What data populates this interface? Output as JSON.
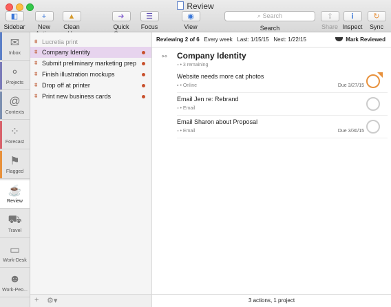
{
  "window": {
    "title": "Review"
  },
  "toolbar": {
    "sidebar": "Sidebar",
    "new_action": "New Action",
    "clean_up": "Clean Up",
    "quick_open": "Quick Open",
    "focus": "Focus",
    "view": "View",
    "search_placeholder": "Search",
    "search_label": "Search",
    "share": "Share",
    "inspect": "Inspect",
    "sync": "Sync"
  },
  "perspectives": [
    {
      "label": "Inbox",
      "icon": "inbox-icon",
      "stripe": "#5b7fc7"
    },
    {
      "label": "Projects",
      "icon": "projects-icon",
      "stripe": "#7a7ab8"
    },
    {
      "label": "Contexts",
      "icon": "contexts-icon",
      "stripe": "#7c8fb0"
    },
    {
      "label": "Forecast",
      "icon": "forecast-icon",
      "stripe": "#d8626b"
    },
    {
      "label": "Flagged",
      "icon": "flag-icon",
      "stripe": "#e8913c"
    },
    {
      "label": "Review",
      "icon": "coffee-cup-icon",
      "stripe": ""
    },
    {
      "label": "Travel",
      "icon": "car-icon",
      "stripe": ""
    },
    {
      "label": "Work-Desk",
      "icon": "laptop-icon",
      "stripe": ""
    },
    {
      "label": "Work-Peo...",
      "icon": "person-icon",
      "stripe": ""
    }
  ],
  "projects": [
    {
      "label": "Lucretia print",
      "dim": true,
      "due_dot": false
    },
    {
      "label": "Company Identity",
      "dim": false,
      "due_dot": true,
      "selected": true
    },
    {
      "label": "Submit preliminary marketing prep",
      "dim": false,
      "due_dot": true
    },
    {
      "label": "Finish illustration mockups",
      "dim": false,
      "due_dot": true
    },
    {
      "label": "Drop off at printer",
      "dim": false,
      "due_dot": true
    },
    {
      "label": "Print new business cards",
      "dim": false,
      "due_dot": true
    }
  ],
  "review_bar": {
    "reviewing": "Reviewing 2 of 6",
    "frequency": "Every week",
    "last": "Last: 1/15/15",
    "next": "Next: 1/22/15",
    "mark_reviewed": "Mark Reviewed"
  },
  "project": {
    "title": "Company Identity",
    "remaining": "• 3 remaining"
  },
  "tasks": [
    {
      "title": "Website needs more cat photos",
      "context": "• Online",
      "due": "Due 3/27/15",
      "flagged": true
    },
    {
      "title": "Email Jen re: Rebrand",
      "context": "• Email",
      "due": "",
      "flagged": false
    },
    {
      "title": "Email Sharon about Proposal",
      "context": "• Email",
      "due": "Due 3/30/15",
      "flagged": false
    }
  ],
  "footer": {
    "status": "3 actions, 1 project"
  },
  "colors": {
    "accent": "#b5522e",
    "flag": "#e8913c",
    "selection": "#e7d4ee",
    "due_dot": "#c8512d"
  }
}
